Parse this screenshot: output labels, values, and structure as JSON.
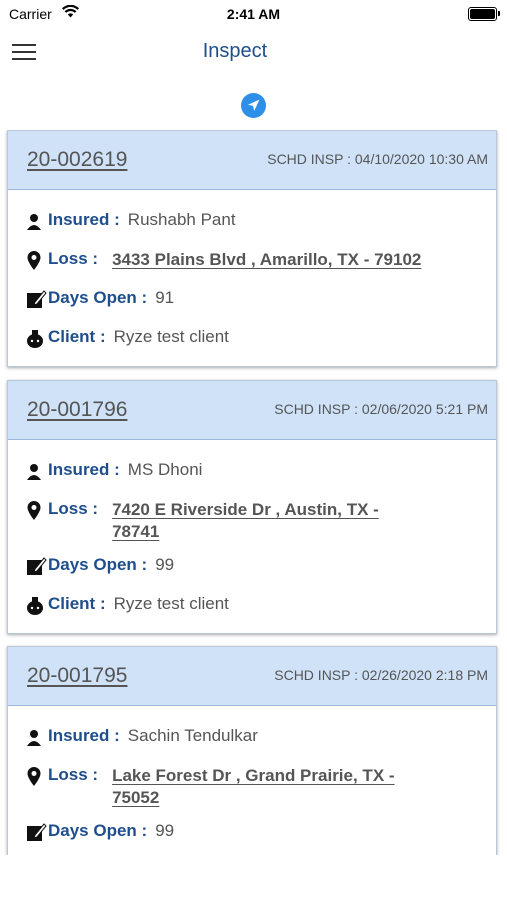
{
  "status_bar": {
    "carrier": "Carrier",
    "time": "2:41 AM"
  },
  "nav": {
    "title": "Inspect",
    "menu_icon": "hamburger-menu-icon",
    "locate_icon": "navigation-arrow-icon"
  },
  "labels": {
    "insured": "Insured :",
    "loss": "Loss :",
    "days_open": "Days Open :",
    "client": "Client :"
  },
  "colors": {
    "header_bg": "#cfe2f7",
    "label_blue": "#1f4e8c",
    "locate_blue": "#2d8fe8"
  },
  "inspections": [
    {
      "claim_no": "20-002619",
      "schedule": "SCHD INSP : 04/10/2020 10:30 AM",
      "insured": "Rushabh Pant",
      "loss_address_line1": "3433 Plains Blvd , Amarillo, TX - 79102",
      "loss_address_line2": "",
      "days_open": "91",
      "client": "Ryze test client"
    },
    {
      "claim_no": "20-001796",
      "schedule": "SCHD INSP : 02/06/2020 5:21 PM",
      "insured": "MS Dhoni",
      "loss_address_line1": "7420 E Riverside Dr , Austin, TX -",
      "loss_address_line2": "78741",
      "days_open": "99",
      "client": "Ryze test client"
    },
    {
      "claim_no": "20-001795",
      "schedule": "SCHD INSP : 02/26/2020 2:18 PM",
      "insured": "Sachin Tendulkar",
      "loss_address_line1": "Lake Forest Dr , Grand Prairie, TX -",
      "loss_address_line2": "75052",
      "days_open": "99",
      "client": ""
    }
  ]
}
